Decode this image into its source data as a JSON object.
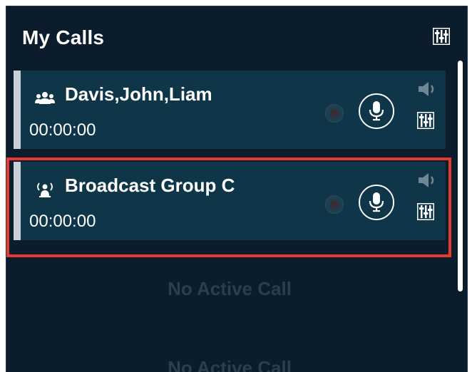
{
  "panel": {
    "title": "My Calls",
    "header_icon": "mixer-icon"
  },
  "calls": [
    {
      "name": "Davis,John,Liam",
      "timer": "00:00:00",
      "type_icon": "group-icon",
      "selected": false
    },
    {
      "name": "Broadcast Group C",
      "timer": "00:00:00",
      "type_icon": "broadcast-icon",
      "selected": true
    }
  ],
  "empty_slots": [
    {
      "label": "No Active Call"
    },
    {
      "label": "No Active Call"
    }
  ],
  "colors": {
    "panel_bg": "#0b1c2c",
    "card_bg": "#0e3648",
    "accent_bar": "#c9cfd4",
    "highlight": "#e8392f",
    "empty_text": "#2c3d4b"
  }
}
